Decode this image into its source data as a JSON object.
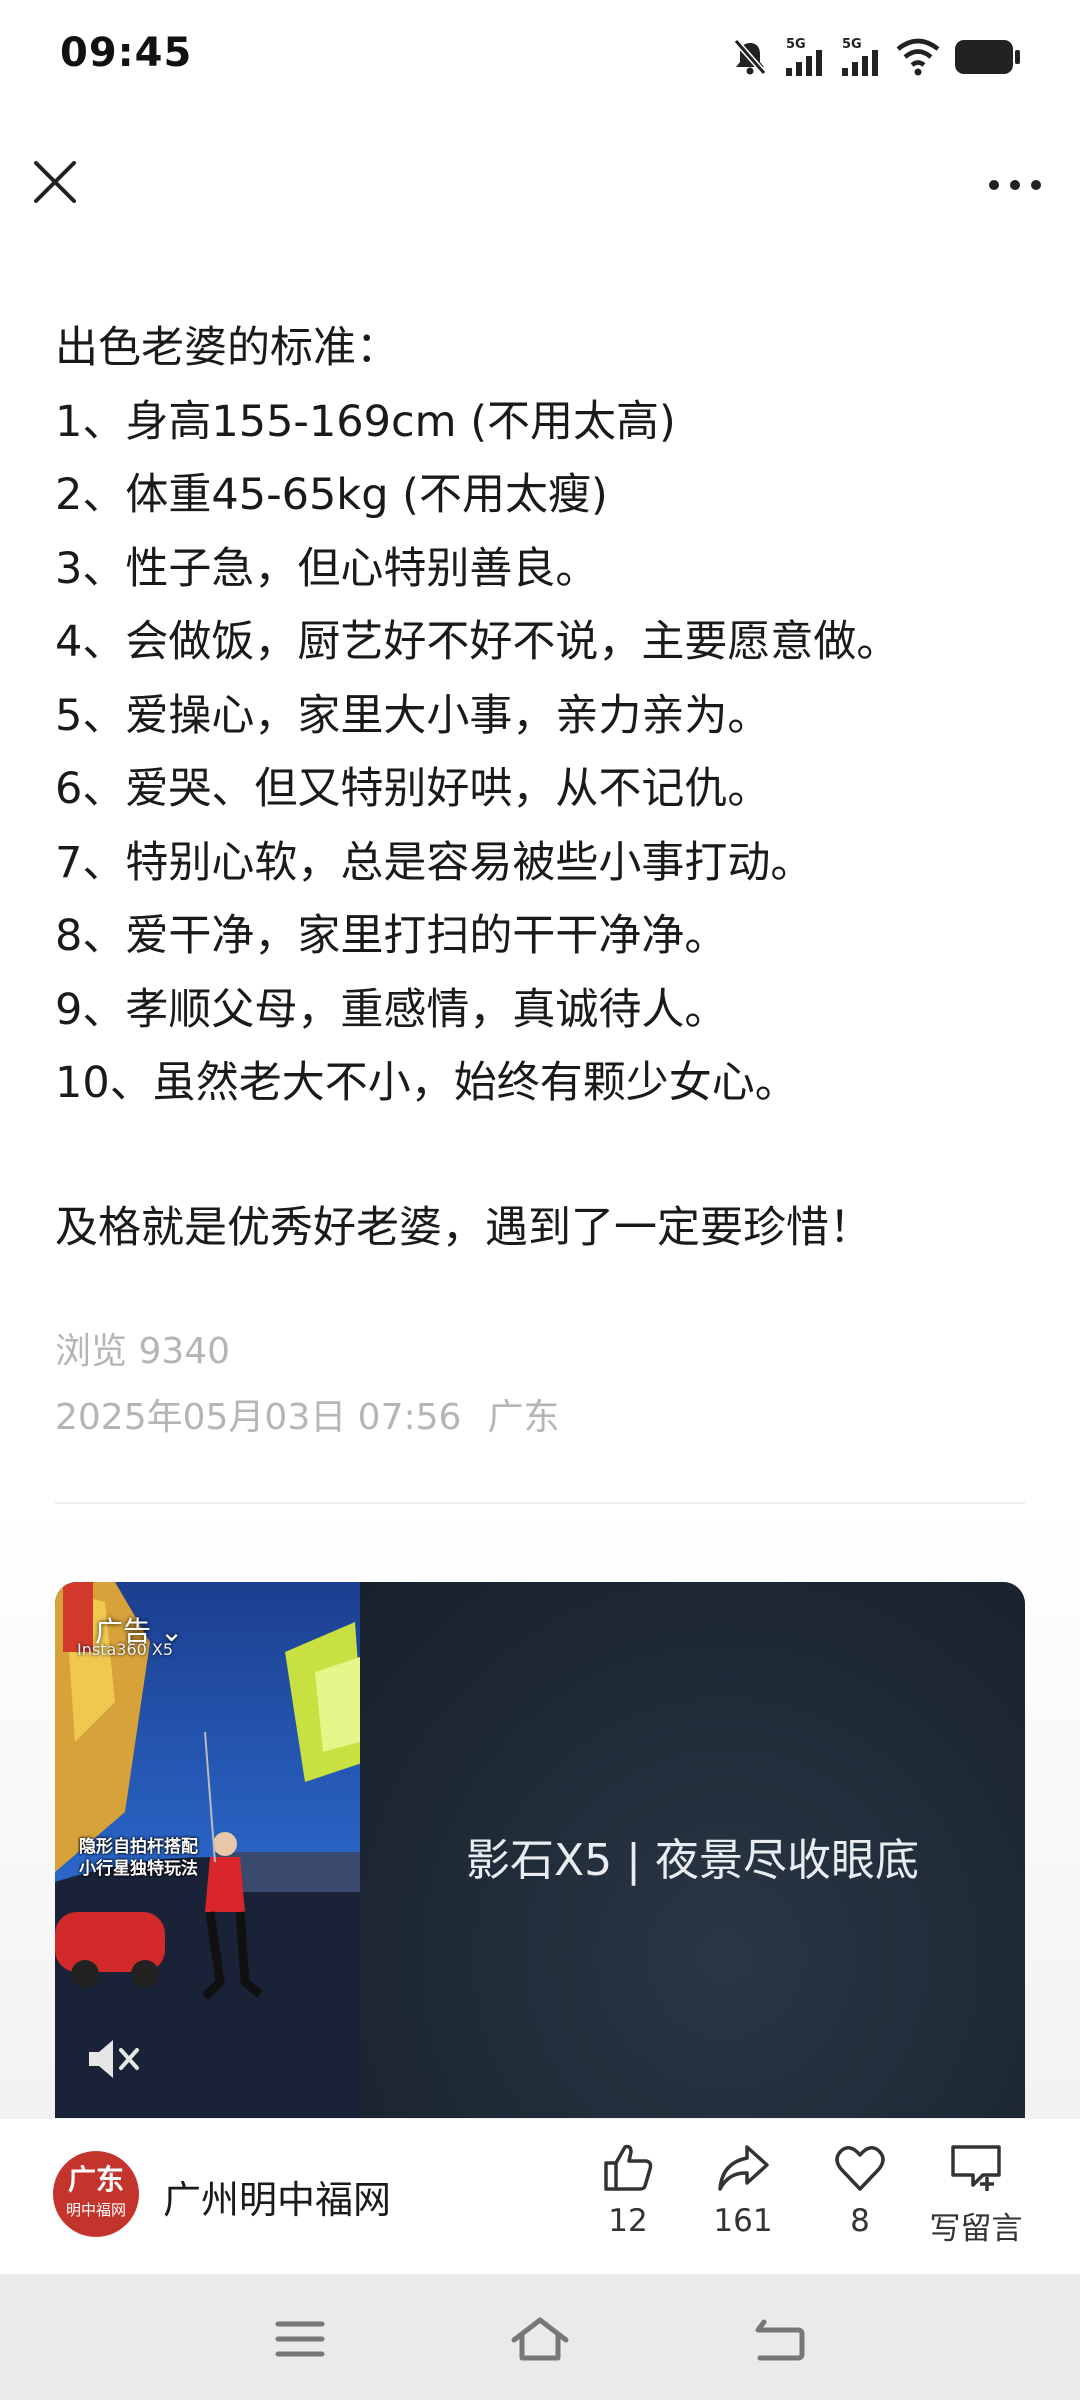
{
  "status_bar": {
    "time": "09:45",
    "network_1": "5G",
    "network_2": "5G",
    "icons": [
      "bell-muted-icon",
      "signal-icon",
      "signal-icon",
      "wifi-icon",
      "battery-icon"
    ]
  },
  "top_nav": {
    "close_icon": "close-icon",
    "more_icon": "more-icon"
  },
  "article": {
    "heading": "出色老婆的标准：",
    "items": [
      "1、身高155-169cm (不用太高)",
      "2、体重45-65kg (不用太瘦)",
      "3、性子急，但心特别善良。",
      "4、会做饭，厨艺好不好不说，主要愿意做。",
      "5、爱操心，家里大小事，亲力亲为。",
      "6、爱哭、但又特别好哄，从不记仇。",
      "7、特别心软，总是容易被些小事打动。",
      "8、爱干净，家里打扫的干干净净。",
      "9、孝顺父母，重感情，真诚待人。",
      "10、虽然老大不小，始终有颗少女心。"
    ],
    "closing": "及格就是优秀好老婆，遇到了一定要珍惜！"
  },
  "meta": {
    "views": "浏览 9340",
    "datetime": "2025年05月03日 07:56",
    "location": "广东"
  },
  "ad": {
    "label": "广告",
    "brand_tag": "Insta360 X5",
    "caption_line1": "隐形自拍杆搭配",
    "caption_line2": "小行星独特玩法",
    "title": "影石X5 | 夜景尽收眼底"
  },
  "action_bar": {
    "publisher_logo_line1": "广东",
    "publisher_logo_line2": "明中福网",
    "publisher_name": "广州明中福网",
    "likes": "12",
    "shares": "161",
    "favorites": "8",
    "comment_label": "写留言"
  },
  "colors": {
    "logo_red": "#c2342c",
    "meta_gray": "#b5b5b5",
    "nav_bg": "#eaeaea"
  }
}
